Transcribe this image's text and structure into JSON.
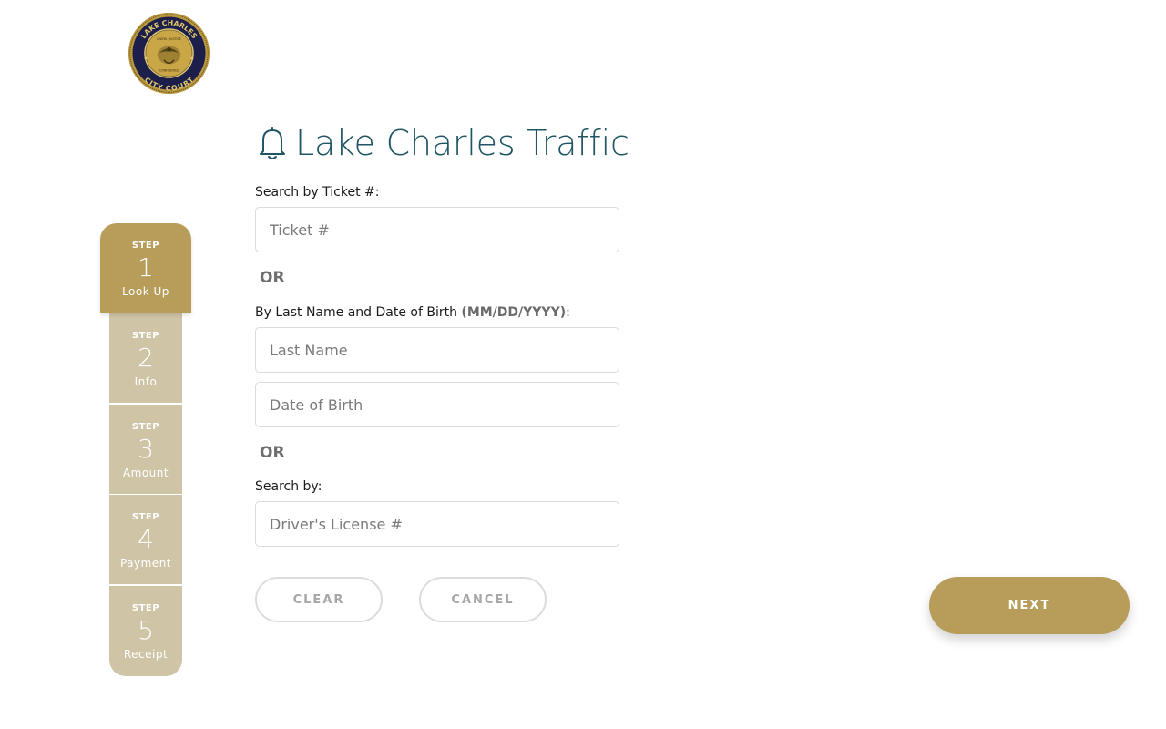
{
  "logo": {
    "ring_top": "LAKE CHARLES",
    "ring_bottom": "CITY COURT",
    "ribbon_top": "UNION · JUSTICE",
    "ribbon_bottom": "CONFIDENCE"
  },
  "header": {
    "title": "Lake Charles Traffic",
    "icon": "bell-icon"
  },
  "steps": [
    {
      "label": "STEP",
      "number": "1",
      "name": "Look Up",
      "active": true
    },
    {
      "label": "STEP",
      "number": "2",
      "name": "Info",
      "active": false
    },
    {
      "label": "STEP",
      "number": "3",
      "name": "Amount",
      "active": false
    },
    {
      "label": "STEP",
      "number": "4",
      "name": "Payment",
      "active": false
    },
    {
      "label": "STEP",
      "number": "5",
      "name": "Receipt",
      "active": false
    }
  ],
  "form": {
    "ticket_label": "Search by Ticket #:",
    "ticket_placeholder": "Ticket #",
    "or_1": "OR",
    "name_dob_label": "By Last Name and Date of Birth ",
    "name_dob_hint": "(MM/DD/YYYY)",
    "name_dob_suffix": ":",
    "last_name_placeholder": "Last Name",
    "dob_placeholder": "Date of Birth",
    "or_2": "OR",
    "search_by_label": "Search by:",
    "license_placeholder": "Driver's License #"
  },
  "buttons": {
    "clear": "CLEAR",
    "cancel": "CANCEL",
    "next": "NEXT"
  },
  "colors": {
    "gold": "#b89d5a",
    "step_inactive": "#d0c4a6",
    "title": "#1f5565",
    "seal_navy": "#1c1f4a",
    "seal_gold": "#c9a646"
  }
}
